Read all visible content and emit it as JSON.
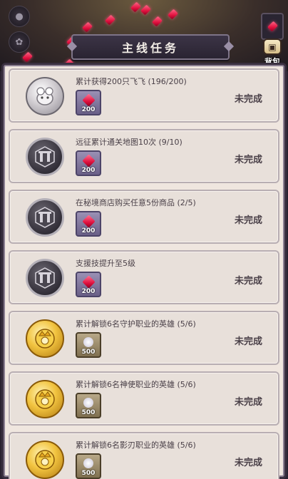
{
  "panel": {
    "title": "主线任务"
  },
  "backpack": {
    "label": "背包"
  },
  "rewards": {
    "gem_color": "#e0103e"
  },
  "tasks": [
    {
      "title": "累计获得200只飞飞 (196/200)",
      "status": "未完成",
      "icon": "feifei-icon",
      "reward_type": "gem",
      "reward_amount": "200"
    },
    {
      "title": "远征累计通关地图10次 (9/10)",
      "status": "未完成",
      "icon": "expedition-icon",
      "reward_type": "gem",
      "reward_amount": "200"
    },
    {
      "title": "在秘境商店购买任意5份商品 (2/5)",
      "status": "未完成",
      "icon": "shop-icon",
      "reward_type": "gem",
      "reward_amount": "200"
    },
    {
      "title": "支援技提升至5级",
      "status": "未完成",
      "icon": "support-skill-icon",
      "reward_type": "gem",
      "reward_amount": "200"
    },
    {
      "title": "累计解锁6名守护职业的英雄 (5/6)",
      "status": "未完成",
      "icon": "guardian-class-icon",
      "reward_type": "coin",
      "reward_amount": "500"
    },
    {
      "title": "累计解锁6名神使职业的英雄 (5/6)",
      "status": "未完成",
      "icon": "apostle-class-icon",
      "reward_type": "coin",
      "reward_amount": "500"
    },
    {
      "title": "累计解锁6名影刃职业的英雄 (5/6)",
      "status": "未完成",
      "icon": "shadowblade-class-icon",
      "reward_type": "coin",
      "reward_amount": "500"
    }
  ]
}
